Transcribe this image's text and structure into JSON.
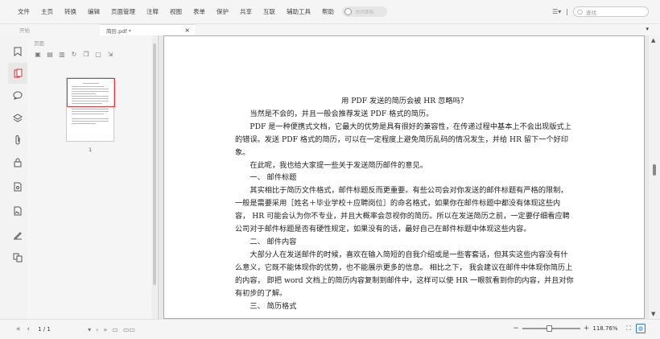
{
  "menu": {
    "items": [
      "文件",
      "主页",
      "转换",
      "编辑",
      "页面管理",
      "注释",
      "视图",
      "表单",
      "保护",
      "共享",
      "互联",
      "辅助工具",
      "帮助"
    ],
    "toggle_label": "关闭面板",
    "search_placeholder": "查找"
  },
  "tabs": {
    "start_label": "开始",
    "active_label": "简历.pdf *",
    "close_glyph": "×",
    "dropdown_glyph": "▾"
  },
  "left_icons": [
    "bookmark-icon",
    "pages-icon",
    "comment-icon",
    "layers-icon",
    "attachment-icon",
    "lock-icon",
    "file-security-icon",
    "image-icon",
    "signature-icon",
    "compare-icon"
  ],
  "thumbnail_panel": {
    "title": "页面",
    "page_number": "1"
  },
  "document": {
    "title": "用 PDF 发送的简历会被 HR 忽略吗？",
    "paragraphs": [
      "当然是不会的，并且一般会推荐发送 PDF 格式的简历。",
      "PDF 是一种便携式文档，它最大的优势是具有很好的兼容性，在传递过程中基本上不会出现版式上的错误。发送 PDF 格式的简历，可以在一定程度上避免简历乱码的情况发生，并给 HR 留下一个好印象。",
      "在此呢，我也给大家提一些关于发送简历邮件的意见。",
      "一、 邮件标题",
      "其实相比于简历文件格式，邮件标题反而更重要。有些公司会对你发送的邮件标题有严格的限制，一般是需要采用［姓名＋毕业学校＋应聘岗位］的命名格式，如果你在邮件标题中都没有体现这些内容， HR 可能会认为你不专业，并且大概率会忽视你的简历。所以在发送简历之前，一定要仔细看应聘公司对于邮件标题是否有硬性规定，如果没有的话，最好自己在邮件标题中体现这些内容。",
      "二、 邮件内容",
      "大部分人在发送邮件的时候，喜欢在输入简短的自我介绍或是一些客套话，但其实这些内容没有什么意义，它既不能体现你的优势，也不能展示更多的信息。 相比之下， 我会建议在邮件中体现你简历上的内容， 即把 word 文档上的简历内容复制到邮件中，这样可以使 HR 一眼就看到你的内容，并且对你有初步的了解。",
      "三、 简历格式"
    ]
  },
  "status": {
    "page_indicator": "1 / 1",
    "zoom": "118.76%",
    "zoom_fraction": 0.42
  }
}
